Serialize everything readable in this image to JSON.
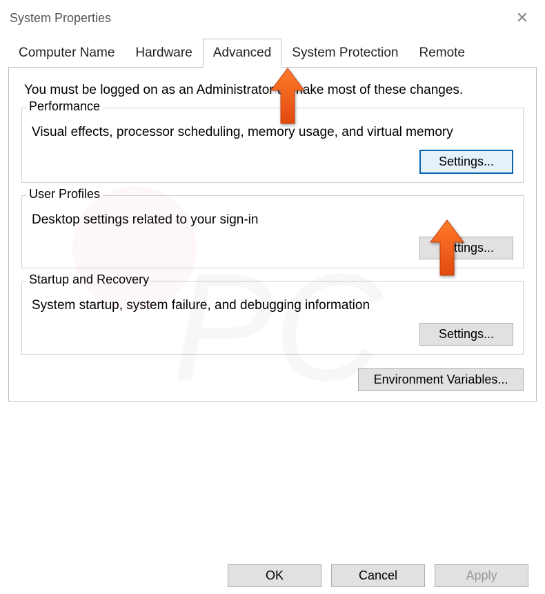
{
  "window": {
    "title": "System Properties"
  },
  "tabs": {
    "computer_name": "Computer Name",
    "hardware": "Hardware",
    "advanced": "Advanced",
    "system_protection": "System Protection",
    "remote": "Remote"
  },
  "intro": "You must be logged on as an Administrator to make most of these changes.",
  "groups": {
    "performance": {
      "legend": "Performance",
      "desc": "Visual effects, processor scheduling, memory usage, and virtual memory",
      "button": "Settings..."
    },
    "user_profiles": {
      "legend": "User Profiles",
      "desc": "Desktop settings related to your sign-in",
      "button": "Settings..."
    },
    "startup": {
      "legend": "Startup and Recovery",
      "desc": "System startup, system failure, and debugging information",
      "button": "Settings..."
    }
  },
  "env_variables_button": "Environment Variables...",
  "buttons": {
    "ok": "OK",
    "cancel": "Cancel",
    "apply": "Apply"
  }
}
